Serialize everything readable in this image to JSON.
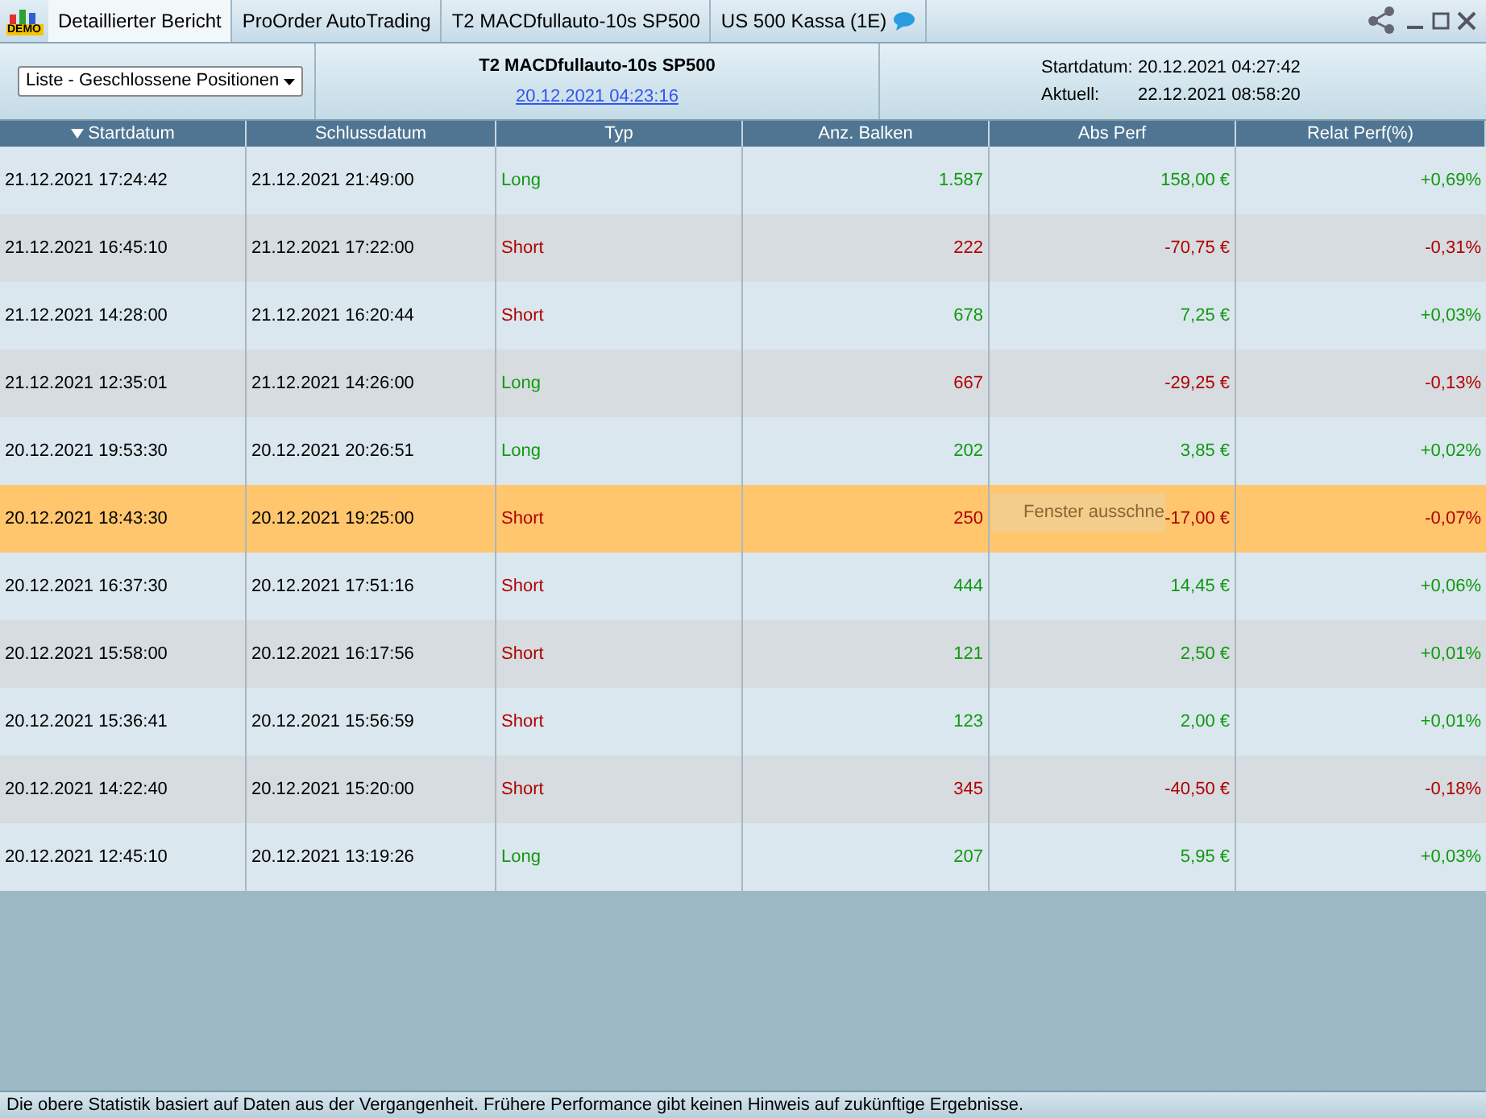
{
  "tabs": [
    {
      "label": "Detaillierter Bericht",
      "selected": true
    },
    {
      "label": "ProOrder AutoTrading",
      "selected": false
    },
    {
      "label": "T2 MACDfullauto-10s SP500",
      "selected": false
    },
    {
      "label": "US 500 Kassa (1E)",
      "selected": false
    }
  ],
  "logo": {
    "label": "DEMO"
  },
  "header": {
    "dropdown": "Liste - Geschlossene Positionen",
    "system_name": "T2 MACDfullauto-10s SP500",
    "system_date": "20.12.2021 04:23:16",
    "start_label": "Startdatum:",
    "start_value": "20.12.2021 04:27:42",
    "current_label": "Aktuell:",
    "current_value": "22.12.2021 08:58:20"
  },
  "table": {
    "columns": [
      {
        "label": "Startdatum",
        "sorted": true
      },
      {
        "label": "Schlussdatum",
        "sorted": false
      },
      {
        "label": "Typ",
        "sorted": false
      },
      {
        "label": "Anz. Balken",
        "sorted": false
      },
      {
        "label": "Abs Perf",
        "sorted": false
      },
      {
        "label": "Relat Perf(%)",
        "sorted": false
      }
    ],
    "rows": [
      {
        "start": "21.12.2021 17:24:42",
        "end": "21.12.2021 21:49:00",
        "type": "Long",
        "kind": "long",
        "bars": "1.587",
        "abs": "158,00 €",
        "rel": "+0,69%",
        "positive": true,
        "selected": false
      },
      {
        "start": "21.12.2021 16:45:10",
        "end": "21.12.2021 17:22:00",
        "type": "Short",
        "kind": "short",
        "bars": "222",
        "abs": "-70,75 €",
        "rel": "-0,31%",
        "positive": false,
        "selected": false
      },
      {
        "start": "21.12.2021 14:28:00",
        "end": "21.12.2021 16:20:44",
        "type": "Short",
        "kind": "short",
        "bars": "678",
        "abs": "7,25 €",
        "rel": "+0,03%",
        "positive": true,
        "selected": false
      },
      {
        "start": "21.12.2021 12:35:01",
        "end": "21.12.2021 14:26:00",
        "type": "Long",
        "kind": "long",
        "bars": "667",
        "abs": "-29,25 €",
        "rel": "-0,13%",
        "positive": false,
        "selected": false
      },
      {
        "start": "20.12.2021 19:53:30",
        "end": "20.12.2021 20:26:51",
        "type": "Long",
        "kind": "long",
        "bars": "202",
        "abs": "3,85 €",
        "rel": "+0,02%",
        "positive": true,
        "selected": false
      },
      {
        "start": "20.12.2021 18:43:30",
        "end": "20.12.2021 19:25:00",
        "type": "Short",
        "kind": "short",
        "bars": "250",
        "abs": "-17,00 €",
        "rel": "-0,07%",
        "positive": false,
        "selected": true
      },
      {
        "start": "20.12.2021 16:37:30",
        "end": "20.12.2021 17:51:16",
        "type": "Short",
        "kind": "short",
        "bars": "444",
        "abs": "14,45 €",
        "rel": "+0,06%",
        "positive": true,
        "selected": false
      },
      {
        "start": "20.12.2021 15:58:00",
        "end": "20.12.2021 16:17:56",
        "type": "Short",
        "kind": "short",
        "bars": "121",
        "abs": "2,50 €",
        "rel": "+0,01%",
        "positive": true,
        "selected": false
      },
      {
        "start": "20.12.2021 15:36:41",
        "end": "20.12.2021 15:56:59",
        "type": "Short",
        "kind": "short",
        "bars": "123",
        "abs": "2,00 €",
        "rel": "+0,01%",
        "positive": true,
        "selected": false
      },
      {
        "start": "20.12.2021 14:22:40",
        "end": "20.12.2021 15:20:00",
        "type": "Short",
        "kind": "short",
        "bars": "345",
        "abs": "-40,50 €",
        "rel": "-0,18%",
        "positive": false,
        "selected": false
      },
      {
        "start": "20.12.2021 12:45:10",
        "end": "20.12.2021 13:19:26",
        "type": "Long",
        "kind": "long",
        "bars": "207",
        "abs": "5,95 €",
        "rel": "+0,03%",
        "positive": true,
        "selected": false
      }
    ]
  },
  "tooltip": {
    "text": "Fenster ausschne"
  },
  "status_bar": "Die obere Statistik basiert auf Daten aus der Vergangenheit. Frühere Performance gibt keinen Hinweis auf zukünftige Ergebnisse."
}
